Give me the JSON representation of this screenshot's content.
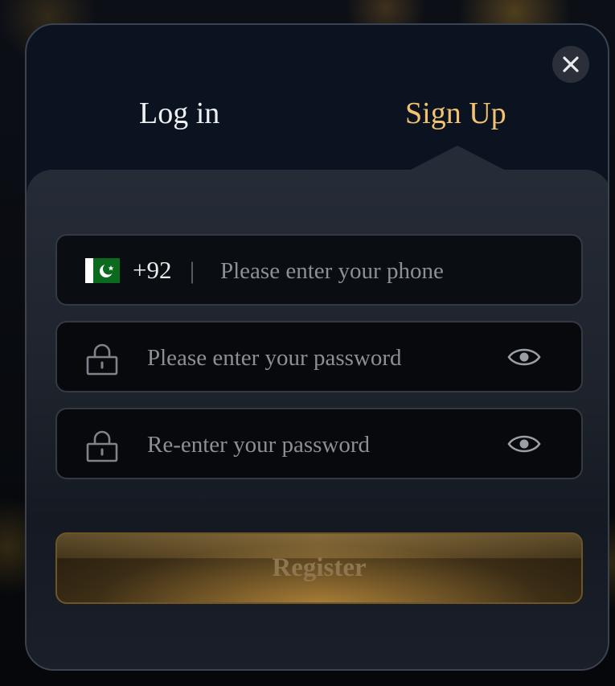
{
  "tabs": {
    "login_label": "Log in",
    "signup_label": "Sign Up",
    "active": "signup"
  },
  "phone": {
    "country_flag": "pakistan-flag-icon",
    "dial_code": "+92",
    "separator": "|",
    "placeholder": "Please enter your phone",
    "value": ""
  },
  "password": {
    "icon": "lock-icon",
    "placeholder": "Please enter your password",
    "value": "",
    "toggle_icon": "eye-icon"
  },
  "confirm_password": {
    "icon": "lock-icon",
    "placeholder": "Re-enter your password",
    "value": "",
    "toggle_icon": "eye-icon"
  },
  "register_button": {
    "label": "Register",
    "enabled": false
  },
  "close_icon": "close-icon",
  "colors": {
    "accent_gold": "#f2c270",
    "modal_bg": "#0c1320",
    "field_bg": "#07090c",
    "flag_green": "#0a6a1e"
  }
}
